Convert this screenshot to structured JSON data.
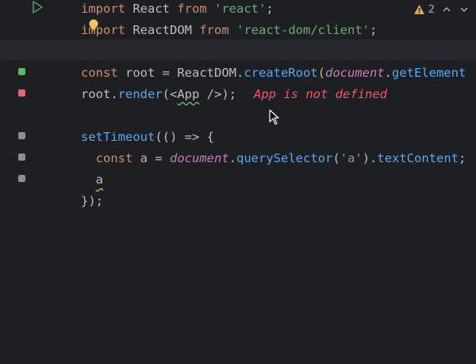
{
  "editor": {
    "warnings": {
      "count": "2",
      "icon": "warning-triangle-icon"
    },
    "lines": {
      "l1": {
        "kw": "import",
        "id": " React ",
        "kw2": "from",
        "sp": " ",
        "str": "'react'",
        "end": ";"
      },
      "l2": {
        "i": "i",
        "kw_rest": "mport",
        "id": " ReactDOM ",
        "kw2": "from",
        "sp": " ",
        "str": "'react-dom/client'",
        "end": ";"
      },
      "l4": {
        "kw": "const",
        "id": " root = ReactDOM.",
        "fn": "createRoot",
        "p": "(",
        "glob": "document",
        "dot": ".",
        "fn2": "getElement"
      },
      "l5": {
        "id": "root.",
        "fn": "render",
        "p": "(<",
        "jsx": "App",
        "end": " />);",
        "err": "App is not defined"
      },
      "l7": {
        "fn": "setTimeout",
        "rest": "(() => {"
      },
      "l8": {
        "indent": "  ",
        "kw": "const",
        "id": " a = ",
        "glob": "document",
        "dot": ".",
        "fn": "querySelector",
        "p": "(",
        "str": "'a'",
        "p2": ").",
        "fn2": "textContent",
        "end": ";"
      },
      "l9": {
        "indent": "  ",
        "id": "a"
      },
      "l10": {
        "id": "});"
      }
    }
  },
  "colors": {
    "background": "#1e1f22",
    "keyword": "#cf8e6d",
    "string": "#6aab73",
    "function": "#56a8f5",
    "global": "#c77dbb",
    "error": "#f75464",
    "marker_green": "#5fb85f",
    "marker_red": "#f0606a",
    "marker_gray": "#8c8f94"
  }
}
